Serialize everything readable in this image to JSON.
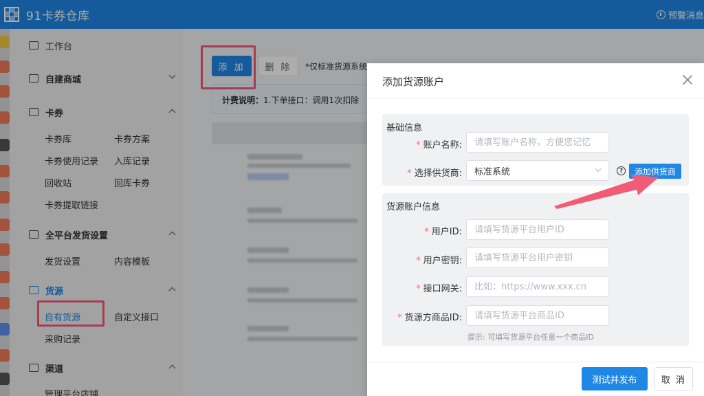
{
  "app": {
    "title": "91卡券仓库",
    "warning_label": "预警消息",
    "brand_color": "#1f87e5",
    "highlight_color": "#f25b76"
  },
  "sidebar": {
    "workbench": "工作台",
    "groups": [
      {
        "label": "自建商城",
        "icon": "store-icon",
        "expanded": false,
        "items": []
      },
      {
        "label": "卡券",
        "icon": "card-icon",
        "expanded": true,
        "items": [
          "卡券库",
          "卡券方案",
          "卡券使用记录",
          "入库记录",
          "回收站",
          "回库卡券",
          "卡券提取链接"
        ]
      },
      {
        "label": "全平台发货设置",
        "icon": "grid-icon",
        "expanded": false,
        "items": [
          "发货设置",
          "内容模板"
        ]
      },
      {
        "label": "货源",
        "icon": "cart-icon",
        "expanded": true,
        "active": true,
        "items": [
          "自有货源",
          "自定义接口",
          "采购记录"
        ]
      },
      {
        "label": "渠道",
        "icon": "bag-icon",
        "expanded": true,
        "items": [
          "管理平台店铺"
        ]
      }
    ]
  },
  "main": {
    "add_button": "添 加",
    "delete_button": "删 除",
    "note": "*仅标准货源系统",
    "billing_label": "计费说明：",
    "billing_text": "1.下单接口：调用1次扣除"
  },
  "dialog": {
    "title": "添加货源账户",
    "basic_section": {
      "title": "基础信息",
      "account_name_label": "账户名称:",
      "account_name_placeholder": "请填写账户名称，方便您记忆",
      "supplier_label": "选择供货商:",
      "supplier_value": "标准系统",
      "add_supplier_button": "添加供货商",
      "help_icon": "question-circle-icon"
    },
    "account_section": {
      "title": "货源账户信息",
      "user_id_label": "用户ID:",
      "user_id_placeholder": "请填写货源平台用户ID",
      "user_secret_label": "用户密钥:",
      "user_secret_placeholder": "请填写货源平台用户密钥",
      "gateway_label": "接口网关:",
      "gateway_placeholder": "比如：https://www.xxx.cn",
      "product_id_label": "货源方商品ID:",
      "product_id_placeholder": "请填写货源平台商品ID",
      "product_id_hint": "提示: 可填写货源平台任意一个商品ID"
    },
    "confirm_button": "测试并发布",
    "cancel_button": "取 消"
  }
}
